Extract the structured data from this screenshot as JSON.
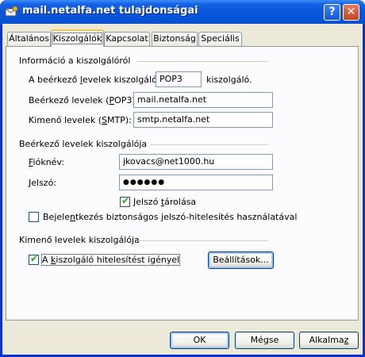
{
  "window": {
    "title": "mail.netalfa.net tulajdonságai",
    "help_glyph": "?",
    "close_glyph": "✕"
  },
  "tabs": [
    {
      "label": "Általános"
    },
    {
      "label": "Kiszolgálók"
    },
    {
      "label": "Kapcsolat"
    },
    {
      "label": "Biztonság"
    },
    {
      "label": "Speciális"
    }
  ],
  "server_info": {
    "heading": "Információ a kiszolgálóról",
    "incoming_type_prefix": "A beérkező ",
    "incoming_type_u": "l",
    "incoming_type_rest": "evelek kiszolgálója",
    "incoming_type_value": "POP3",
    "incoming_type_suffix": "kiszolgáló.",
    "pop3_prefix": "Beérkező levelek (",
    "pop3_u": "P",
    "pop3_rest": "OP3):",
    "pop3_value": "mail.netalfa.net",
    "smtp_prefix": "Kimenő levelek (",
    "smtp_u": "S",
    "smtp_rest": "MTP):",
    "smtp_value": "smtp.netalfa.net"
  },
  "incoming_server": {
    "heading": "Beérkező levelek kiszolgálója",
    "account_u": "F",
    "account_rest": "ióknév:",
    "account_value": "jkovacs@net1000.hu",
    "password_u": "J",
    "password_rest": "elszó:",
    "password_value": "●●●●●●",
    "remember_u": "t",
    "remember_pre": "Jelszó ",
    "remember_rest": "árolása",
    "remember_checked": true,
    "spa_pre": "Bejele",
    "spa_u": "n",
    "spa_rest": "tkezés biztonságos jelszó-hitelesítés használatával",
    "spa_checked": false
  },
  "outgoing_server": {
    "heading": "Kimenő levelek kiszolgálója",
    "auth_pre": "A ",
    "auth_u": "k",
    "auth_rest": "iszolgáló hitelesítést igényel",
    "auth_checked": true,
    "settings_label": "Beállítások..."
  },
  "buttons": {
    "ok": "OK",
    "cancel": "Mégse",
    "apply_pre": "Alkalma",
    "apply_u": "z"
  },
  "colors": {
    "titlebar": "#0a57dc",
    "dialog_bg": "#ece9d8",
    "tab_highlight": "#ffc83c",
    "checkmark": "#21a121"
  }
}
